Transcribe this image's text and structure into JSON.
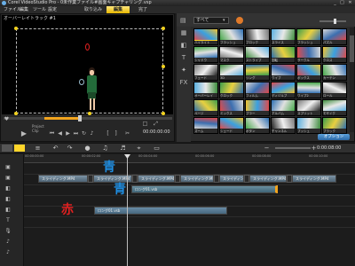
{
  "window": {
    "title": "Corel VideoStudio Pro - 0未作業ファイル#画面キャプチャリング.vsp",
    "minimize": "_",
    "maximize": "□",
    "close": "✕"
  },
  "menu": {
    "items": [
      "ファイル",
      "編集",
      "ツール",
      "設定"
    ],
    "steps": [
      "取り込み",
      "編集",
      "完了"
    ]
  },
  "preview": {
    "label": "オーバーレイトラック #1",
    "project_label": "Project",
    "clip_label": "Clip",
    "timecode": "00:00:00:00",
    "progress": 0.45
  },
  "library": {
    "category": "すべて",
    "thumbnails": [
      {
        "label": "ハイライト"
      },
      {
        "label": "フラッシュ"
      },
      {
        "label": "ブロック"
      },
      {
        "label": "スライス"
      },
      {
        "label": "フラッシュ"
      },
      {
        "label": "パズル"
      },
      {
        "label": "シャドウ"
      },
      {
        "label": "マスク"
      },
      {
        "label": "ストライプ"
      },
      {
        "label": "回転"
      },
      {
        "label": "サークル"
      },
      {
        "label": "クロス"
      },
      {
        "label": "フェード"
      },
      {
        "label": "3D"
      },
      {
        "label": "リング"
      },
      {
        "label": "ワイプ"
      },
      {
        "label": "ボックス"
      },
      {
        "label": "カーテン"
      },
      {
        "label": "オーバーレイ"
      },
      {
        "label": "クロック"
      },
      {
        "label": "フィルム"
      },
      {
        "label": "ディゾルブ"
      },
      {
        "label": "ワイプ2"
      },
      {
        "label": "ロール"
      },
      {
        "label": "ページ"
      },
      {
        "label": "ミックス"
      },
      {
        "label": "ブラー"
      },
      {
        "label": "アルバム"
      },
      {
        "label": "スプリット"
      },
      {
        "label": "モザイク"
      },
      {
        "label": "ズーム"
      },
      {
        "label": "シェード"
      },
      {
        "label": "ボタン"
      },
      {
        "label": "チャンネル"
      },
      {
        "label": "プッシュ"
      },
      {
        "label": "ブラック"
      }
    ],
    "options_label": "オプション"
  },
  "timeline": {
    "time_display": "0:00:08:00",
    "ruler": [
      "00:00:00:00",
      "00:00:02:00",
      "00:00:04:00",
      "00:00:06:00",
      "00:00:08:00",
      "00:00:10:00"
    ],
    "clips_video": [
      "スライディング.MP4",
      "スライディング.MP4",
      "スライディング.MP4",
      "スライディング.MP4",
      "スライディング.MP4",
      "スライディング.MP4",
      "スライディング.MP4"
    ],
    "clip_overlay": "ロング01.vsb",
    "clip_overlay_small": "ロング01.vsb",
    "clip_lower": "ロング01.vsb"
  },
  "annotations": {
    "blue_1": "青",
    "blue_2": "青",
    "red_1": "赤"
  },
  "colors": {
    "accent": "#ffd52a",
    "annotation_blue": "#1f8de0",
    "annotation_red": "#e02020"
  }
}
